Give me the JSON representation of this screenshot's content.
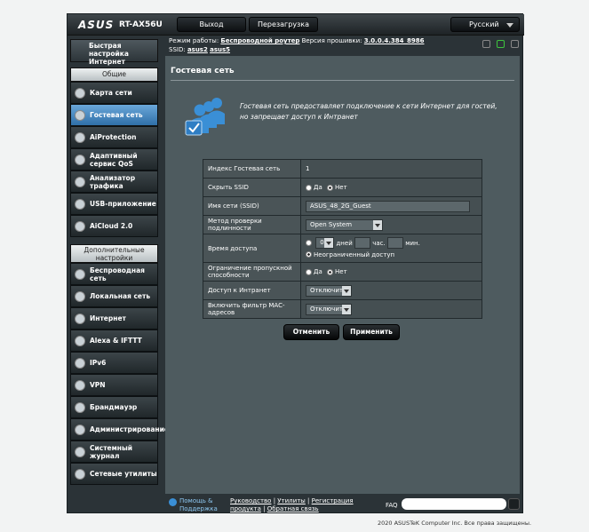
{
  "brand": "ASUS",
  "model": "RT-AX56U",
  "header": {
    "logout": "Выход",
    "reboot": "Перезагрузка",
    "language": "Русский"
  },
  "status": {
    "mode_label": "Режим работы:",
    "mode_value": "Беспроводной роутер",
    "fw_label": "Версия прошивки:",
    "fw_value": "3.0.0.4.384_8986",
    "ssid_label": "SSID:",
    "ssid1": "asus2",
    "ssid2": "asus5"
  },
  "sidebar": {
    "quick_setup": "Быстрая настройка Интернет",
    "general_header": "Общие",
    "general": [
      {
        "label": "Карта сети",
        "icon": "network-map-icon"
      },
      {
        "label": "Гостевая сеть",
        "icon": "guest-network-icon"
      },
      {
        "label": "AiProtection",
        "icon": "aiprotection-icon"
      },
      {
        "label": "Адаптивный сервис QoS",
        "icon": "qos-icon"
      },
      {
        "label": "Анализатор трафика",
        "icon": "traffic-analyzer-icon"
      },
      {
        "label": "USB-приложение",
        "icon": "usb-icon"
      },
      {
        "label": "AiCloud 2.0",
        "icon": "aicloud-icon"
      }
    ],
    "advanced_header": "Дополнительные настройки",
    "advanced": [
      {
        "label": "Беспроводная сеть",
        "icon": "wireless-icon"
      },
      {
        "label": "Локальная сеть",
        "icon": "lan-icon"
      },
      {
        "label": "Интернет",
        "icon": "wan-icon"
      },
      {
        "label": "Alexa & IFTTT",
        "icon": "alexa-icon"
      },
      {
        "label": "IPv6",
        "icon": "ipv6-icon"
      },
      {
        "label": "VPN",
        "icon": "vpn-icon"
      },
      {
        "label": "Брандмауэр",
        "icon": "firewall-icon"
      },
      {
        "label": "Администрирование",
        "icon": "admin-icon"
      },
      {
        "label": "Системный журнал",
        "icon": "syslog-icon"
      },
      {
        "label": "Сетевые утилиты",
        "icon": "network-tools-icon"
      }
    ]
  },
  "page": {
    "title": "Гостевая сеть",
    "intro": "Гостевая сеть предоставляет подключение к сети Интернет для гостей, но запрещает доступ к Интранет"
  },
  "form": {
    "index_label": "Индекс Гостевая сеть",
    "index_value": "1",
    "hide_ssid_label": "Скрыть SSID",
    "yes": "Да",
    "no": "Нет",
    "ssid_label": "Имя сети (SSID)",
    "ssid_value": "ASUS_48_2G_Guest",
    "auth_label": "Метод проверки подлинности",
    "auth_value": "Open System",
    "access_time_label": "Время доступа",
    "days_value": "0",
    "days_unit": "дней",
    "hours_unit": "час.",
    "min_unit": "мин.",
    "unlimited": "Неограниченный доступ",
    "bw_label": "Ограничение пропускной способности",
    "intranet_label": "Доступ к Интранет",
    "intranet_value": "Отключить",
    "mac_label": "Включить фильтр MAC-адресов",
    "mac_value": "Отключить"
  },
  "buttons": {
    "cancel": "Отменить",
    "apply": "Применить"
  },
  "footer": {
    "help": "Помощь & Поддержка",
    "manual": "Руководство",
    "utilities": "Утилиты",
    "registration": "Регистрация продукта",
    "feedback": "Обратная связь",
    "faq": "FAQ",
    "copyright": "2020 ASUSTeK Computer Inc. Все права защищены."
  }
}
